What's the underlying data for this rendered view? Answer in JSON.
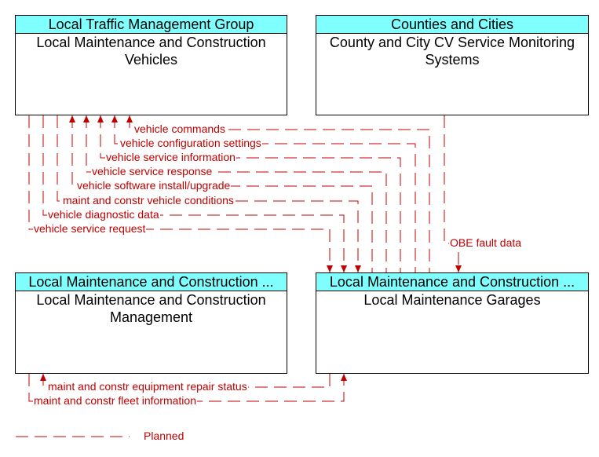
{
  "boxes": [
    {
      "header": "Local Traffic Management Group",
      "title": "Local Maintenance and Construction Vehicles"
    },
    {
      "header": "Counties and Cities",
      "title": "County and City CV Service Monitoring Systems"
    },
    {
      "header": "Local Maintenance and Construction ...",
      "title": "Local Maintenance and Construction Management"
    },
    {
      "header": "Local Maintenance and Construction ...",
      "title": "Local Maintenance Garages"
    }
  ],
  "flows": [
    "vehicle commands",
    "vehicle configuration settings",
    "vehicle service information",
    "vehicle service response",
    "vehicle software install/upgrade",
    "maint and constr vehicle conditions",
    "vehicle diagnostic data",
    "vehicle service request",
    "OBE fault data",
    "maint and constr equipment repair status",
    "maint and constr fleet information"
  ],
  "legend": {
    "label": "Planned",
    "color": "#c00000"
  }
}
